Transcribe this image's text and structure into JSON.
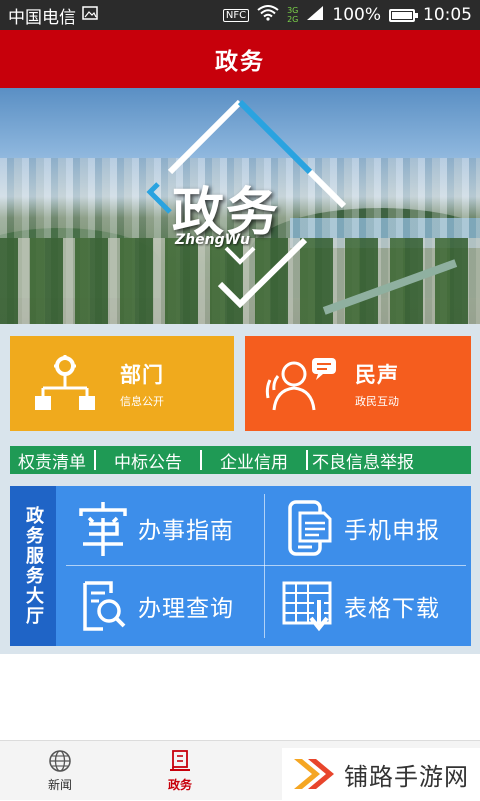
{
  "status_bar": {
    "carrier": "中国电信",
    "nfc": "NFC",
    "net_top": "3G",
    "net_bottom": "2G",
    "battery": "100%",
    "battery_level": 1.0,
    "time": "10:05"
  },
  "header": {
    "title": "政务"
  },
  "banner": {
    "logo_title": "政务",
    "logo_subtitle": "ZhengWu"
  },
  "tiles": [
    {
      "title": "部门",
      "subtitle": "信息公开",
      "icon": "org-chart-icon",
      "color": "#f0aa1d"
    },
    {
      "title": "民声",
      "subtitle": "政民互动",
      "icon": "people-chat-icon",
      "color": "#f55d1e"
    }
  ],
  "links": [
    "权责清单",
    "中标公告",
    "企业信用",
    "不良信息举报"
  ],
  "hall": {
    "side_label": "政务服务大厅",
    "items": [
      {
        "label": "办事指南",
        "icon": "guide-icon"
      },
      {
        "label": "手机申报",
        "icon": "phone-form-icon"
      },
      {
        "label": "办理查询",
        "icon": "search-doc-icon"
      },
      {
        "label": "表格下载",
        "icon": "table-download-icon"
      }
    ]
  },
  "bottom_nav": {
    "items": [
      {
        "label": "新闻",
        "icon": "globe-icon"
      },
      {
        "label": "政务",
        "icon": "building-icon",
        "active": true
      }
    ]
  },
  "watermark": {
    "text": "铺路手游网",
    "icon": "double-chevron-icon"
  },
  "colors": {
    "primary_red": "#c7000b",
    "green": "#1f9a55",
    "blue": "#3d8eea",
    "dark_blue": "#1f64c6"
  }
}
